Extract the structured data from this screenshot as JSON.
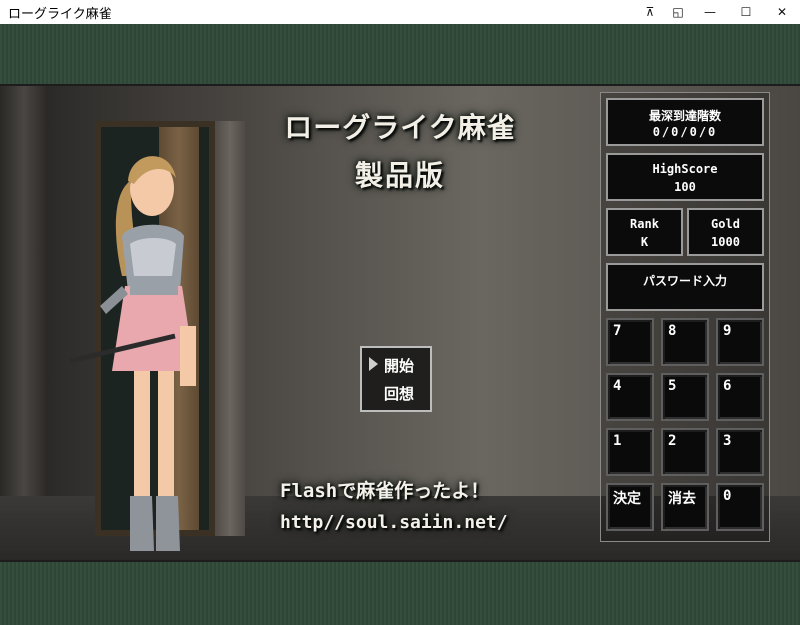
{
  "window": {
    "title": "ローグライク麻雀",
    "buttons": {
      "pin": "⊼",
      "restore_small": "◱",
      "minimize": "—",
      "maximize": "☐",
      "close": "✕"
    }
  },
  "game": {
    "title_line1": "ローグライク麻雀",
    "title_line2": "製品版",
    "menu": {
      "start": "開始",
      "recollection": "回想"
    },
    "caption_line1": "Flashで麻雀作ったよ！",
    "caption_line2": "http//soul.saiin.net/"
  },
  "stats": {
    "deepest_label": "最深到達階数",
    "deepest_value": "0/0/0/0",
    "highscore_label": "HighScore",
    "highscore_value": "100",
    "rank_label": "Rank",
    "rank_value": "K",
    "gold_label": "Gold",
    "gold_value": "1000",
    "password_label": "パスワード入力"
  },
  "keypad": {
    "k7": "7",
    "k8": "8",
    "k9": "9",
    "k4": "4",
    "k5": "5",
    "k6": "6",
    "k1": "1",
    "k2": "2",
    "k3": "3",
    "decide": "決定",
    "erase": "消去",
    "k0": "0"
  },
  "colors": {
    "felt": "#2f4838",
    "panel_bg": "#0b0b0b",
    "panel_border": "#9a9a9a",
    "title_text": "#f2efe6"
  }
}
